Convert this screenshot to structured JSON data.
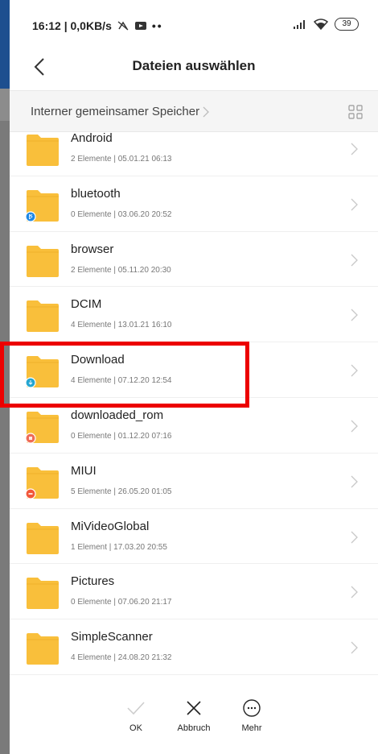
{
  "status_bar": {
    "time_info": "16:12 | 0,0KB/s",
    "battery": "39"
  },
  "header": {
    "title": "Dateien auswählen"
  },
  "path": {
    "crumb": "Interner gemeinsamer Speicher"
  },
  "folders": [
    {
      "name": "Android",
      "meta": "2 Elemente | 05.01.21 06:13",
      "badge": "none"
    },
    {
      "name": "bluetooth",
      "meta": "0 Elemente | 03.06.20 20:52",
      "badge": "bluetooth"
    },
    {
      "name": "browser",
      "meta": "2 Elemente | 05.11.20 20:30",
      "badge": "none"
    },
    {
      "name": "DCIM",
      "meta": "4 Elemente | 13.01.21 16:10",
      "badge": "none"
    },
    {
      "name": "Download",
      "meta": "4 Elemente | 07.12.20 12:54",
      "badge": "download"
    },
    {
      "name": "downloaded_rom",
      "meta": "0 Elemente | 01.12.20 07:16",
      "badge": "rom"
    },
    {
      "name": "MIUI",
      "meta": "5 Elemente | 26.05.20 01:05",
      "badge": "miui"
    },
    {
      "name": "MiVideoGlobal",
      "meta": "1 Element | 17.03.20 20:55",
      "badge": "none"
    },
    {
      "name": "Pictures",
      "meta": "0 Elemente | 07.06.20 21:17",
      "badge": "none"
    },
    {
      "name": "SimpleScanner",
      "meta": "4 Elemente | 24.08.20 21:32",
      "badge": "none"
    }
  ],
  "actions": {
    "ok": "OK",
    "cancel": "Abbruch",
    "more": "Mehr"
  },
  "colors": {
    "folder": "#f9bf3b",
    "highlight": "#ec0000"
  }
}
